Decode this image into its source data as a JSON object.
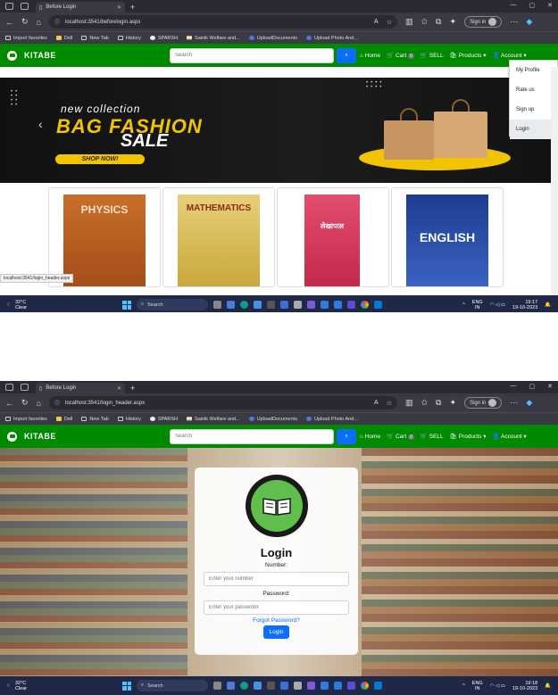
{
  "browser": {
    "tab_title_1": "Before Login",
    "tab_title_2": "Before Login",
    "url_1": "localhost:3541/beforelogin.aspx",
    "url_2": "localhost:3541/login_header.aspx",
    "sign_in": "Sign in",
    "bookmarks": [
      {
        "label": "Import favorites"
      },
      {
        "label": "Dell"
      },
      {
        "label": "New Tab"
      },
      {
        "label": "History"
      },
      {
        "label": "SPARSH"
      },
      {
        "label": "Sainik Welfare and..."
      },
      {
        "label": "UploadDocuments"
      },
      {
        "label": "Upload Photo And..."
      }
    ],
    "status_link": "localhost:3541/login_header.aspx"
  },
  "site": {
    "brand": "KITABE",
    "search_placeholder": "Search",
    "nav": {
      "home": "Home",
      "cart": "Cart",
      "cart_count": "0",
      "sell": "SELL",
      "products": "Products",
      "account": "Account"
    },
    "account_menu": [
      "My Profile",
      "Rate us",
      "Sign up",
      "Login"
    ]
  },
  "banner": {
    "line1": "new collection",
    "line2": "BAG FASHION",
    "line3": "SALE",
    "cta": "SHOP NOW!"
  },
  "books": [
    {
      "title": "PHYSICS"
    },
    {
      "title": "MATHEMATICS"
    },
    {
      "title": "लेखापाल"
    },
    {
      "title": "ENGLISH"
    }
  ],
  "login": {
    "title": "Login",
    "number_label": "Number:",
    "number_placeholder": "Enter your number",
    "password_label": "Password:",
    "password_placeholder": "Enter your password",
    "forgot": "Forgot Password?",
    "button": "Login"
  },
  "taskbar": {
    "temp": "32°C",
    "weather": "Clear",
    "search": "Search",
    "lang1": "ENG",
    "lang2": "IN",
    "time_1": "19:17",
    "time_2": "19:18",
    "date": "19-10-2023"
  },
  "colors": {
    "navbar_green": "#008a00",
    "primary_blue": "#0d6efd",
    "banner_yellow": "#f2c400"
  }
}
